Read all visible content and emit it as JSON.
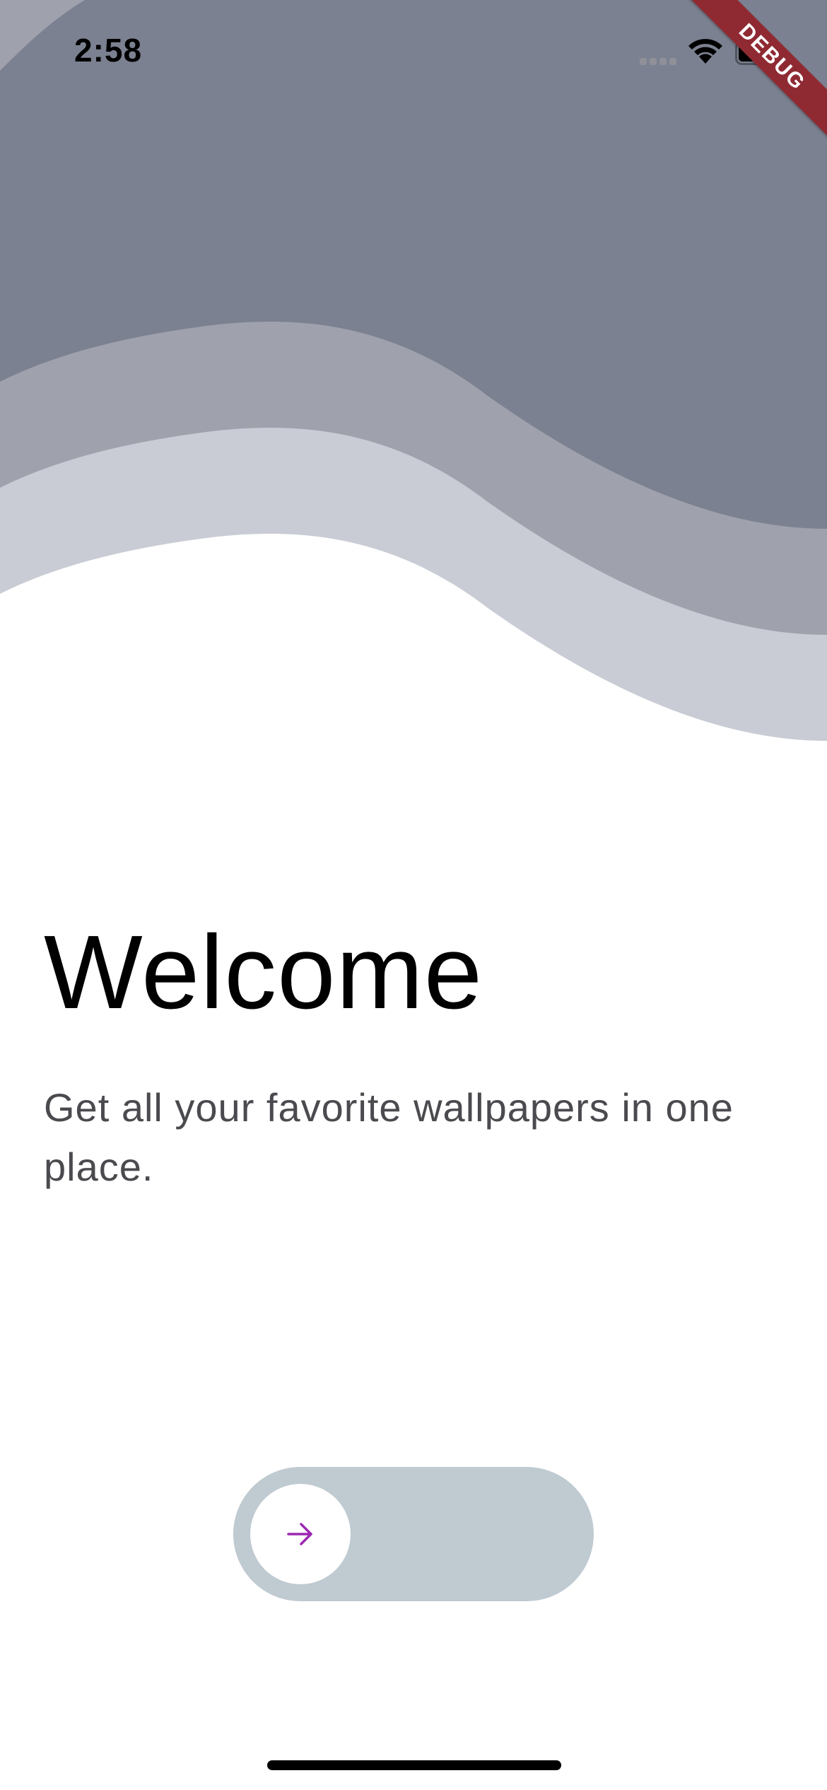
{
  "status_bar": {
    "time": "2:58",
    "icons": [
      "cellular-signal-icon",
      "wifi-icon",
      "battery-icon"
    ]
  },
  "debug_banner": {
    "label": "DEBUG",
    "color": "#8f2a33"
  },
  "welcome": {
    "title": "Welcome",
    "subtitle": "Get all your favorite wallpapers in one place."
  },
  "slider": {
    "icon": "arrow-right-icon",
    "progress": 0,
    "accent_color": "#9c27b0",
    "track_color": "#bfcad1"
  },
  "waves": {
    "colors": [
      "#7c8191",
      "#9fa2ad",
      "#c9ccd4"
    ]
  }
}
